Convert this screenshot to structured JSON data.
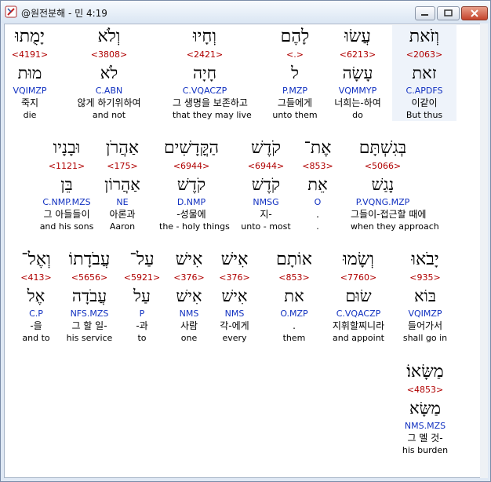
{
  "window": {
    "title": "@원전분해 - 민 4:19"
  },
  "rows": [
    [
      {
        "heb": "וְזֹאת",
        "num": "<2063>",
        "lem": "זאת",
        "pars": "C.APDFS",
        "kor": "이같이",
        "eng": "But thus",
        "hl": true
      },
      {
        "heb": "עֲשׂוּ",
        "num": "<6213>",
        "lem": "עָשָׂה",
        "pars": "VQMMYP",
        "kor": "너희는-하여",
        "eng": "do"
      },
      {
        "heb": "לָהֶם",
        "num": "<.>",
        "lem": "ל",
        "pars": "P.MZP",
        "kor": "그들에게",
        "eng": "unto them"
      },
      {
        "heb": "וְחָיוּ",
        "num": "<2421>",
        "lem": "חָיָה",
        "pars": "C.VQACZP",
        "kor": "그 생명을 보존하고",
        "eng": "that they may live"
      },
      {
        "heb": "וְלֹא",
        "num": "<3808>",
        "lem": "לֹא",
        "pars": "C.ABN",
        "kor": "않게 하기위하여",
        "eng": "and not"
      },
      {
        "heb": "יָמֻתוּ",
        "num": "<4191>",
        "lem": "מוּת",
        "pars": "VQIMZP",
        "kor": "죽지",
        "eng": "die"
      }
    ],
    [
      {
        "heb": "בְּגִשְׁתָּם",
        "num": "<5066>",
        "lem": "נָגַשׁ",
        "pars": "P.VQNG.MZP",
        "kor": "그들이-접근할 때에",
        "eng": "when they approach"
      },
      {
        "heb": "אֶת־",
        "num": "<853>",
        "lem": "אֵת",
        "pars": "O",
        "kor": ".",
        "eng": "."
      },
      {
        "heb": "קֹדֶשׁ",
        "num": "<6944>",
        "lem": "קֹדֶשׁ",
        "pars": "NMSG",
        "kor": "지-",
        "eng": "unto - most"
      },
      {
        "heb": "הַקֳּדָשִׁים",
        "num": "<6944>",
        "lem": "קֹדֶשׁ",
        "pars": "D.NMP",
        "kor": "-성물에",
        "eng": "the - holy things"
      },
      {
        "heb": "אַהֲרֹן",
        "num": "<175>",
        "lem": "אַהֲרוֹן",
        "pars": "NE",
        "kor": "아론과",
        "eng": "Aaron"
      },
      {
        "heb": "וּבָנָיו",
        "num": "<1121>",
        "lem": "בֵּן",
        "pars": "C.NMP.MZS",
        "kor": "그 아들들이",
        "eng": "and his sons"
      }
    ],
    [
      {
        "heb": "יָבֹאוּ",
        "num": "<935>",
        "lem": "בּוֹא",
        "pars": "VQIMZP",
        "kor": "들어가서",
        "eng": "shall go in"
      },
      {
        "heb": "וְשָׂמוּ",
        "num": "<7760>",
        "lem": "שׂוּם",
        "pars": "C.VQACZP",
        "kor": "지휘할찌니라",
        "eng": "and appoint"
      },
      {
        "heb": "אוֹתָם",
        "num": "<853>",
        "lem": "את",
        "pars": "O.MZP",
        "kor": ".",
        "eng": "them"
      },
      {
        "heb": "אִישׁ",
        "num": "<376>",
        "lem": "אִישׁ",
        "pars": "NMS",
        "kor": "각-에게",
        "eng": "every"
      },
      {
        "heb": "אִישׁ",
        "num": "<376>",
        "lem": "אִישׁ",
        "pars": "NMS",
        "kor": "사람",
        "eng": "one"
      },
      {
        "heb": "עַל־",
        "num": "<5921>",
        "lem": "עַל",
        "pars": "P",
        "kor": "-과",
        "eng": "to"
      },
      {
        "heb": "עֲבֹדָתוֹ",
        "num": "<5656>",
        "lem": "עֲבֹדָה",
        "pars": "NFS.MZS",
        "kor": "그 할 일-",
        "eng": "his service"
      },
      {
        "heb": "וְאֶל־",
        "num": "<413>",
        "lem": "אֶל",
        "pars": "C.P",
        "kor": "-을",
        "eng": "and to"
      }
    ],
    [
      {
        "heb": "מַשָּׂאוֹ׃",
        "num": "<4853>",
        "lem": "מַשָּׂא",
        "pars": "NMS.MZS",
        "kor": "그 멜 것-",
        "eng": "his burden"
      }
    ]
  ]
}
